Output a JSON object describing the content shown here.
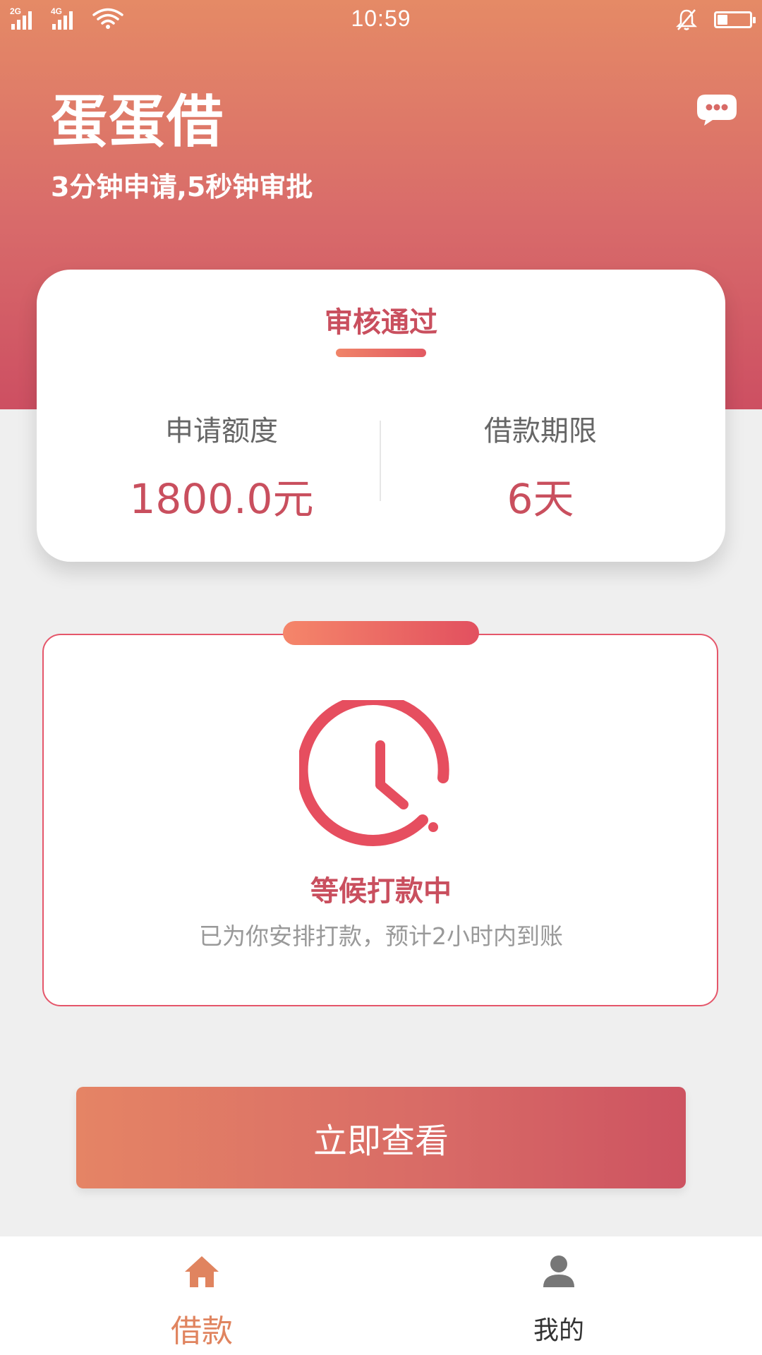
{
  "status_bar": {
    "network_1": "2G",
    "network_2": "4G",
    "time": "10:59",
    "battery_level": 0.3,
    "icons": [
      "signal-icon",
      "wifi-icon",
      "mute-bell-icon",
      "battery-icon"
    ]
  },
  "header": {
    "app_name": "蛋蛋借",
    "slogan": "3分钟申请,5秒钟审批",
    "message_icon": "chat-bubble-icon"
  },
  "review_card": {
    "title": "审核通过",
    "amount_label": "申请额度",
    "amount_value": "1800.0元",
    "term_label": "借款期限",
    "term_value": "6天"
  },
  "payout_card": {
    "icon": "clock-icon",
    "status": "等候打款中",
    "description": "已为你安排打款，预计2小时内到账"
  },
  "view_button": {
    "label": "立即查看"
  },
  "tab_bar": {
    "tabs": [
      {
        "label": "借款",
        "icon": "home-icon",
        "active": true
      },
      {
        "label": "我的",
        "icon": "user-icon",
        "active": false
      }
    ]
  },
  "colors": {
    "accent": "#c94f5e",
    "header_top": "#e58a66",
    "header_bottom": "#cd4f62",
    "active_tab": "#e0845f"
  }
}
